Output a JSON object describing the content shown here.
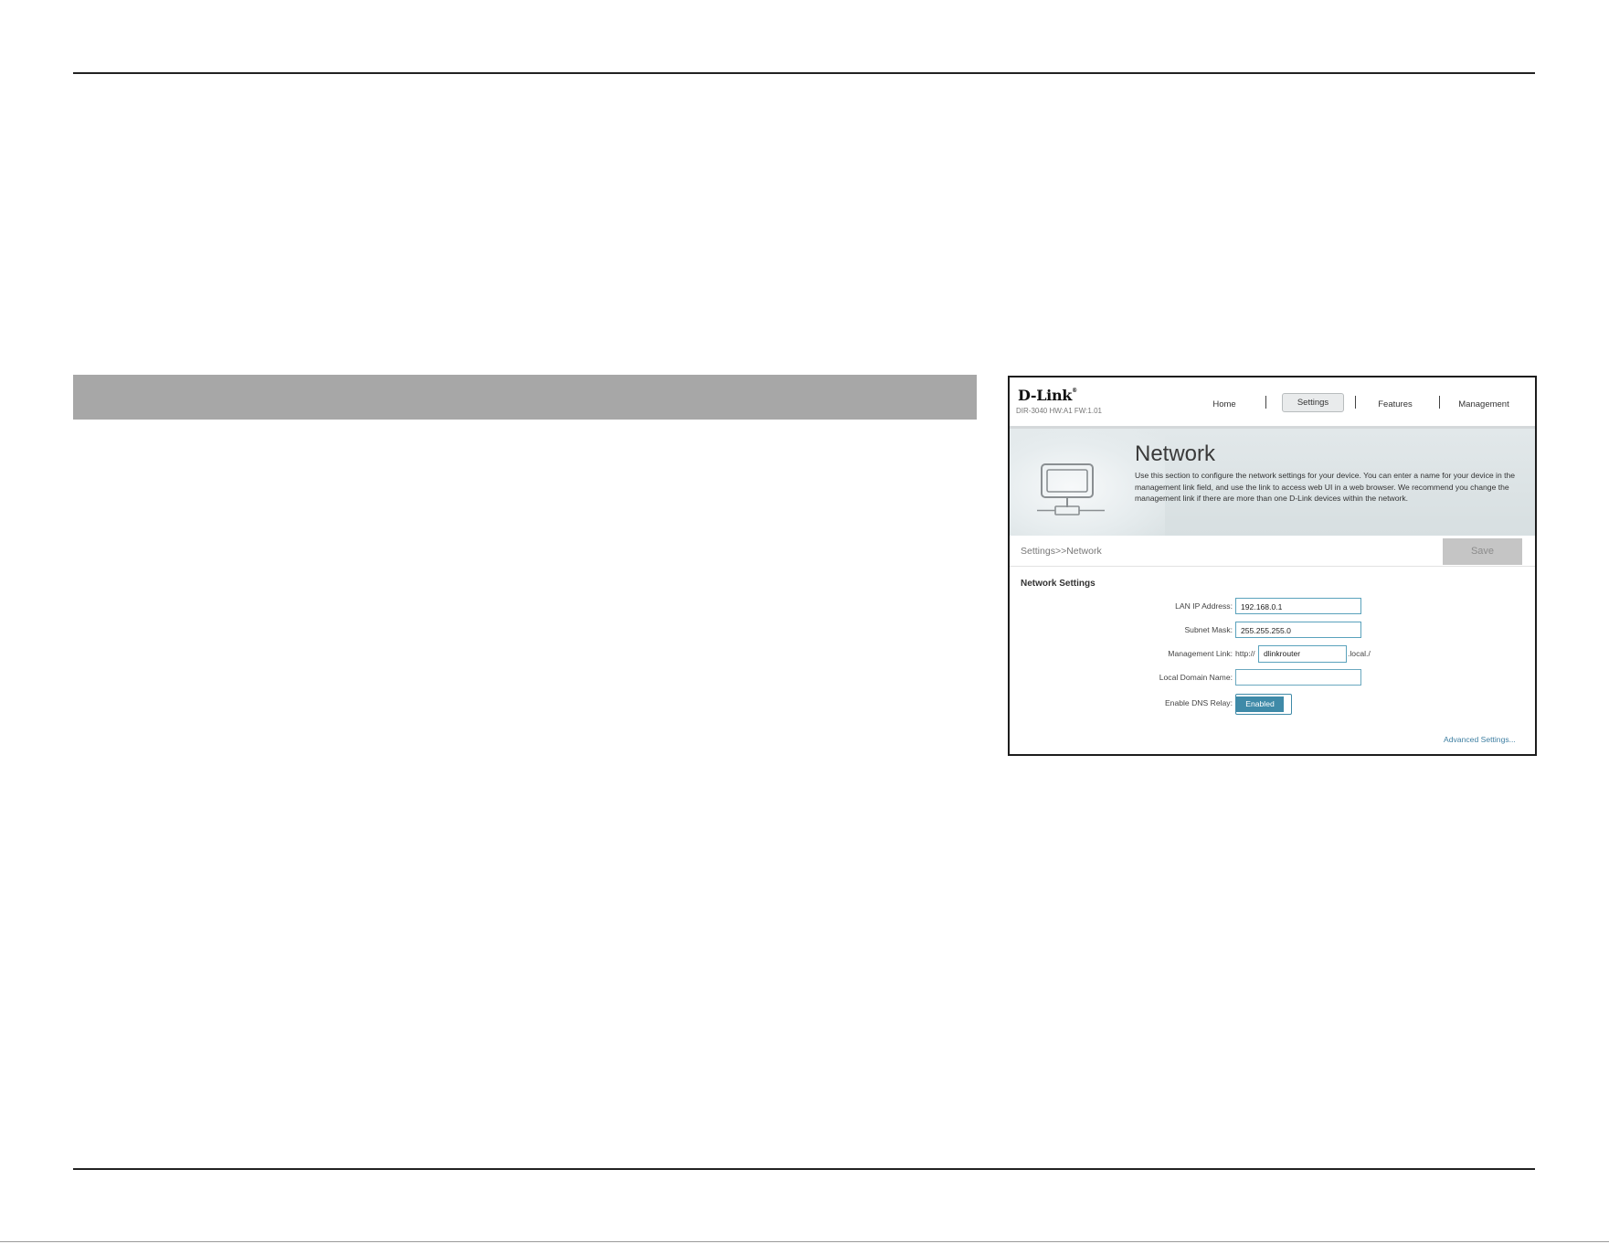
{
  "app": {
    "logo": "D-Link",
    "model": "DIR-3040 HW:A1 FW:1.01"
  },
  "nav": {
    "home": "Home",
    "settings": "Settings",
    "features": "Features",
    "management": "Management",
    "active": "Settings"
  },
  "banner": {
    "title": "Network",
    "description": "Use this section to configure the network settings for your device. You can enter a name for your device in the management link field, and use the link to access web UI in a web browser. We recommend you change the management link if there are more than one D-Link devices within the network.",
    "icon": "network-computer-icon"
  },
  "breadcrumb": "Settings>>Network",
  "save_label": "Save",
  "network_settings": {
    "heading": "Network Settings",
    "lan_ip_label": "LAN IP Address:",
    "lan_ip_value": "192.168.0.1",
    "subnet_label": "Subnet Mask:",
    "subnet_value": "255.255.255.0",
    "mgmt_label": "Management Link:",
    "mgmt_prefix": "http://",
    "mgmt_value": "dlinkrouter",
    "mgmt_suffix": ".local./",
    "domain_label": "Local Domain Name:",
    "domain_value": "",
    "dns_label": "Enable DNS Relay:",
    "dns_value": "Enabled"
  },
  "advanced_link": "Advanced Settings...",
  "colors": {
    "accent": "#3f8aa8",
    "section_bar": "#a7a7a7",
    "save_disabled": "#c5c5c5"
  }
}
